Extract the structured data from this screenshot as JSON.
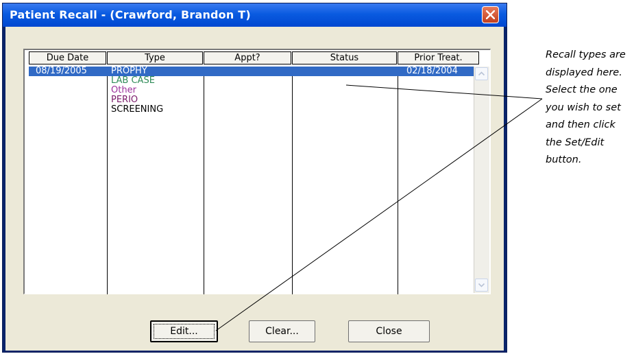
{
  "window": {
    "title": "Patient Recall - (Crawford, Brandon T)"
  },
  "table": {
    "columns": [
      "Due Date",
      "Type",
      "Appt?",
      "Status",
      "Prior Treat."
    ],
    "rows": [
      {
        "due_date": "08/19/2005",
        "type": "PROPHY",
        "appt": "",
        "status": "",
        "prior_treat": "02/18/2004",
        "type_color": "#ffffff",
        "selected": true
      },
      {
        "due_date": "",
        "type": "LAB CASE",
        "appt": "",
        "status": "",
        "prior_treat": "",
        "type_color": "#2e8b57",
        "selected": false
      },
      {
        "due_date": "",
        "type": "Other",
        "appt": "",
        "status": "",
        "prior_treat": "",
        "type_color": "#9b2f9b",
        "selected": false
      },
      {
        "due_date": "",
        "type": "PERIO",
        "appt": "",
        "status": "",
        "prior_treat": "",
        "type_color": "#7a1a6a",
        "selected": false
      },
      {
        "due_date": "",
        "type": "SCREENING",
        "appt": "",
        "status": "",
        "prior_treat": "",
        "type_color": "#000000",
        "selected": false
      }
    ]
  },
  "buttons": {
    "edit": "Edit...",
    "clear": "Clear...",
    "close": "Close"
  },
  "callout": {
    "lines": [
      "Recall types are",
      "displayed here.",
      "Select the one",
      "you wish to set",
      "and then click",
      "the Set/Edit",
      "button."
    ]
  },
  "colors": {
    "selection": "#316ac5",
    "titlebar": "#0a5be0",
    "dialog_bg": "#ece9d8"
  }
}
